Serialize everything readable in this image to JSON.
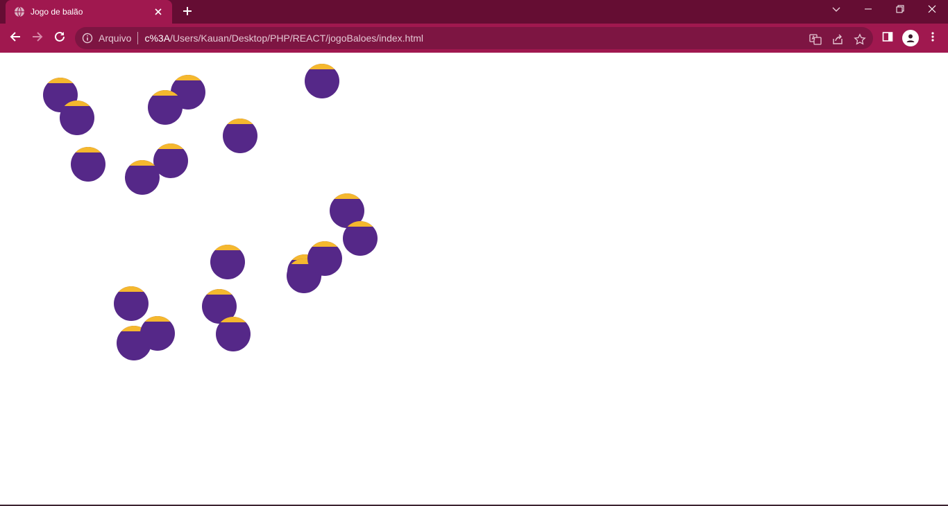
{
  "browser": {
    "tab_title": "Jogo de balão",
    "icons": {
      "favicon": "globe-icon",
      "tab_close": "close-icon",
      "new_tab": "plus-icon",
      "tab_search": "chevron-down-icon",
      "minimize": "minimize-icon",
      "restore": "restore-icon",
      "close_window": "close-icon",
      "back": "arrow-left-icon",
      "forward": "arrow-right-icon",
      "reload": "reload-icon",
      "site_info": "info-icon",
      "translate": "translate-icon",
      "share": "share-icon",
      "bookmark": "star-icon",
      "side_panel": "side-panel-icon",
      "profile": "profile-icon",
      "menu": "kebab-menu-icon"
    },
    "omnibox": {
      "scheme_label": "Arquivo",
      "url_host": "c%3A",
      "url_path": "/Users/Kauan/Desktop/PHP/REACT/jogoBaloes/index.html"
    }
  },
  "game": {
    "balloon_count": 18
  },
  "colors": {
    "tab_strip": "#650d33",
    "toolbar": "#a0184f",
    "omnibox": "#7d1542",
    "balloon_body": "#552888",
    "balloon_top": "#f5b82e",
    "page_background": "#ffffff"
  }
}
